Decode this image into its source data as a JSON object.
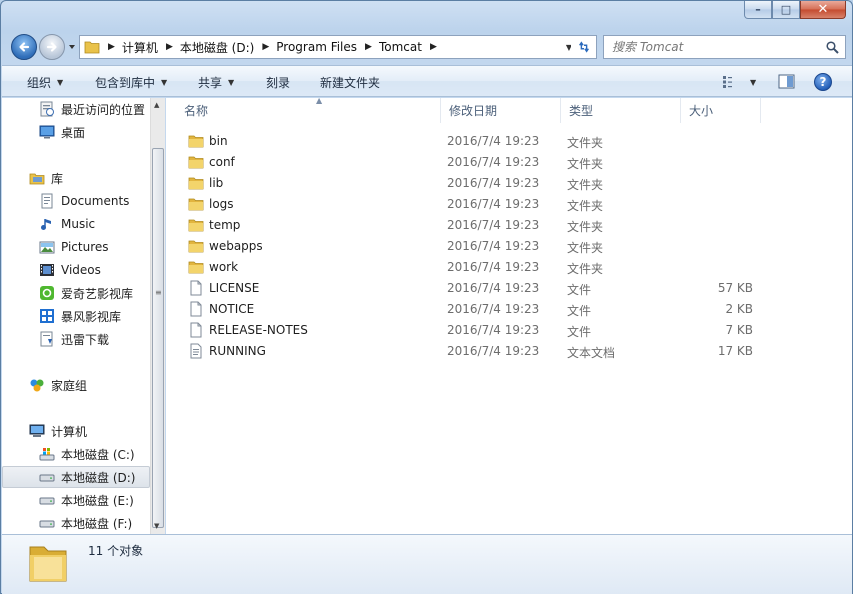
{
  "window": {
    "minimize": "–",
    "maximize": "□",
    "close": "✕"
  },
  "address": {
    "crumbs": [
      "计算机",
      "本地磁盘 (D:)",
      "Program Files",
      "Tomcat"
    ]
  },
  "search": {
    "placeholder": "搜索 Tomcat"
  },
  "toolbar": {
    "organize": "组织",
    "include_in_library": "包含到库中",
    "share": "共享",
    "burn": "刻录",
    "new_folder": "新建文件夹",
    "help": "?"
  },
  "nav": {
    "items": [
      {
        "label": "最近访问的位置",
        "icon": "recent-places-icon"
      },
      {
        "label": "桌面",
        "icon": "desktop-icon"
      },
      {
        "label": "库",
        "icon": "libraries-icon"
      },
      {
        "label": "Documents",
        "icon": "documents-icon"
      },
      {
        "label": "Music",
        "icon": "music-icon"
      },
      {
        "label": "Pictures",
        "icon": "pictures-icon"
      },
      {
        "label": "Videos",
        "icon": "videos-icon"
      },
      {
        "label": "爱奇艺影视库",
        "icon": "iqiyi-icon"
      },
      {
        "label": "暴风影视库",
        "icon": "baofeng-icon"
      },
      {
        "label": "迅雷下载",
        "icon": "xunlei-icon"
      },
      {
        "label": "家庭组",
        "icon": "homegroup-icon"
      },
      {
        "label": "计算机",
        "icon": "computer-icon"
      },
      {
        "label": "本地磁盘 (C:)",
        "icon": "drive-c-icon"
      },
      {
        "label": "本地磁盘 (D:)",
        "icon": "drive-icon"
      },
      {
        "label": "本地磁盘 (E:)",
        "icon": "drive-icon"
      },
      {
        "label": "本地磁盘 (F:)",
        "icon": "drive-icon"
      }
    ],
    "selected": "本地磁盘 (D:)"
  },
  "columns": {
    "name": "名称",
    "modified": "修改日期",
    "type": "类型",
    "size": "大小"
  },
  "files": [
    {
      "name": "bin",
      "modified": "2016/7/4 19:23",
      "type": "文件夹",
      "size": "",
      "kind": "folder"
    },
    {
      "name": "conf",
      "modified": "2016/7/4 19:23",
      "type": "文件夹",
      "size": "",
      "kind": "folder"
    },
    {
      "name": "lib",
      "modified": "2016/7/4 19:23",
      "type": "文件夹",
      "size": "",
      "kind": "folder"
    },
    {
      "name": "logs",
      "modified": "2016/7/4 19:23",
      "type": "文件夹",
      "size": "",
      "kind": "folder"
    },
    {
      "name": "temp",
      "modified": "2016/7/4 19:23",
      "type": "文件夹",
      "size": "",
      "kind": "folder"
    },
    {
      "name": "webapps",
      "modified": "2016/7/4 19:23",
      "type": "文件夹",
      "size": "",
      "kind": "folder"
    },
    {
      "name": "work",
      "modified": "2016/7/4 19:23",
      "type": "文件夹",
      "size": "",
      "kind": "folder"
    },
    {
      "name": "LICENSE",
      "modified": "2016/7/4 19:23",
      "type": "文件",
      "size": "57 KB",
      "kind": "file"
    },
    {
      "name": "NOTICE",
      "modified": "2016/7/4 19:23",
      "type": "文件",
      "size": "2 KB",
      "kind": "file"
    },
    {
      "name": "RELEASE-NOTES",
      "modified": "2016/7/4 19:23",
      "type": "文件",
      "size": "7 KB",
      "kind": "file"
    },
    {
      "name": "RUNNING",
      "modified": "2016/7/4 19:23",
      "type": "文本文档",
      "size": "17 KB",
      "kind": "text"
    }
  ],
  "details": {
    "count": "11 个对象"
  }
}
